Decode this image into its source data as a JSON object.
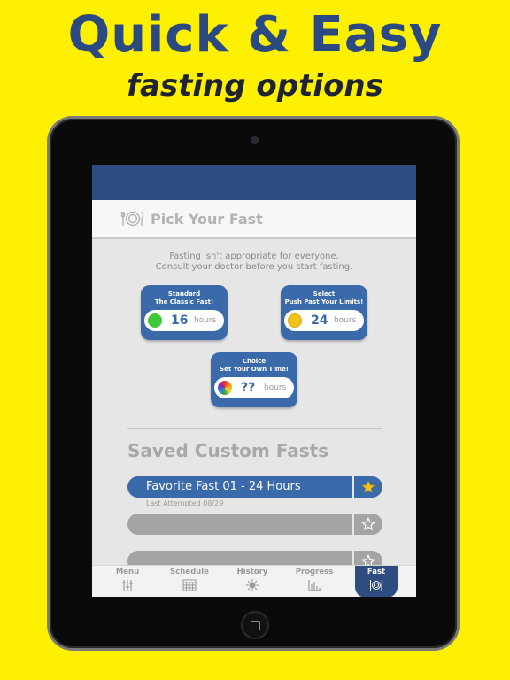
{
  "promo": {
    "title": "Quick & Easy",
    "subtitle": "fasting options"
  },
  "header": {
    "title": "Pick Your Fast",
    "icon": "plate-utensils-icon"
  },
  "disclaimer": {
    "line1": "Fasting isn't appropriate for everyone.",
    "line2": "Consult your doctor before you start fasting."
  },
  "fasts": [
    {
      "name": "Standard",
      "tagline": "The Classic Fast!",
      "hours": "16",
      "unit": "hours",
      "dot_color": "#3ec93a"
    },
    {
      "name": "Select",
      "tagline": "Push Past Your Limits!",
      "hours": "24",
      "unit": "hours",
      "dot_color": "#f2c31b"
    },
    {
      "name": "Choice",
      "tagline": "Set Your Own Time!",
      "hours": "??",
      "unit": "hours",
      "dot_color": "rainbow"
    }
  ],
  "saved": {
    "title": "Saved Custom Fasts",
    "items": [
      {
        "label": "Favorite Fast 01 - 24 Hours",
        "subtext": "Last Attempted 08/29",
        "favorited": true
      },
      {
        "label": "",
        "favorited": false
      },
      {
        "label": "",
        "favorited": false
      }
    ]
  },
  "tabs": [
    {
      "label": "Menu",
      "icon": "sliders-icon"
    },
    {
      "label": "Schedule",
      "icon": "calendar-icon"
    },
    {
      "label": "History",
      "icon": "sun-icon"
    },
    {
      "label": "Progress",
      "icon": "bar-chart-icon"
    },
    {
      "label": "Fast",
      "icon": "plate-utensils-icon",
      "active": true
    }
  ],
  "colors": {
    "background": "#fdf000",
    "brand_blue": "#2d4c80",
    "card_blue": "#3a6aa9",
    "star_yellow": "#f2c31b"
  }
}
